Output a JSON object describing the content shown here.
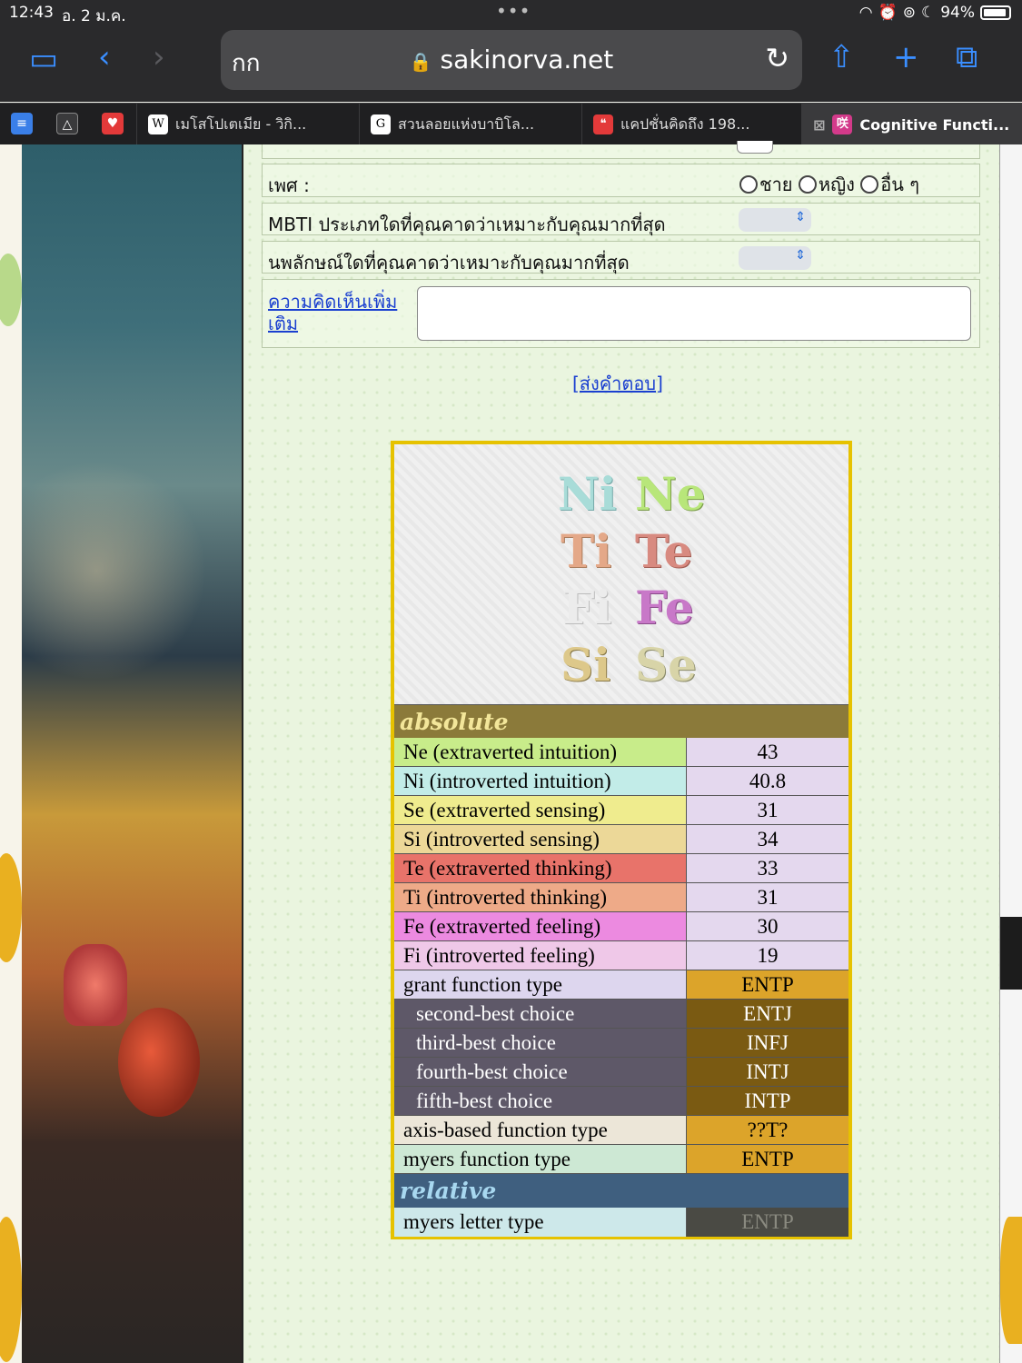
{
  "status": {
    "time": "12:43",
    "date": "อ. 2 ม.ค.",
    "battery": "94%"
  },
  "browser": {
    "aa_label": "กก",
    "url": "sakinorva.net",
    "tabs": [
      {
        "label": "เมโสโปเตเมีย - วิกิ...",
        "favicon": "W"
      },
      {
        "label": "สวนลอยแห่งบาบิโล...",
        "favicon": "G"
      },
      {
        "label": "แคปชั่นคิดถึง 198...",
        "favicon": "❝"
      },
      {
        "label": "Cognitive Functi...",
        "favicon": "咲"
      }
    ]
  },
  "form": {
    "gender_label": "เพศ :",
    "gender_options": [
      "ชาย",
      "หญิง",
      "อื่น ๆ"
    ],
    "mbti_label": "MBTI ประเภทใดที่คุณคาดว่าเหมาะกับคุณมากที่สุด",
    "enneagram_label": "นพลักษณ์ใดที่คุณคาดว่าเหมาะกับคุณมากที่สุด",
    "comment_link_line1": "ความคิดเห็นเพิ่ม",
    "comment_link_line2": "เติม",
    "submit_label": "[ส่งคำตอบ]"
  },
  "results": {
    "functions_grid": [
      [
        "Ni",
        "Ne"
      ],
      [
        "Ti",
        "Te"
      ],
      [
        "Fi",
        "Fe"
      ],
      [
        "Si",
        "Se"
      ]
    ],
    "absolute_header": "absolute",
    "scores": [
      {
        "label": "Ne (extraverted intuition)",
        "value": "43",
        "color": "#c8ec8a"
      },
      {
        "label": "Ni (introverted intuition)",
        "value": "40.8",
        "color": "#c2ece8"
      },
      {
        "label": "Se (extraverted sensing)",
        "value": "31",
        "color": "#efec8e"
      },
      {
        "label": "Si (introverted sensing)",
        "value": "34",
        "color": "#ecd898"
      },
      {
        "label": "Te (extraverted thinking)",
        "value": "33",
        "color": "#e8736a"
      },
      {
        "label": "Ti (introverted thinking)",
        "value": "31",
        "color": "#eeaa88"
      },
      {
        "label": "Fe (extraverted feeling)",
        "value": "30",
        "color": "#ec8ae0"
      },
      {
        "label": "Fi (introverted feeling)",
        "value": "19",
        "color": "#efc8e8"
      }
    ],
    "grant_label": "grant function type",
    "grant_value": "ENTP",
    "grant_choices": [
      {
        "label": "second-best choice",
        "value": "ENTJ"
      },
      {
        "label": "third-best choice",
        "value": "INFJ"
      },
      {
        "label": "fourth-best choice",
        "value": "INTJ"
      },
      {
        "label": "fifth-best choice",
        "value": "INTP"
      }
    ],
    "axis_label": "axis-based function type",
    "axis_value": "??T?",
    "myers_function_label": "myers function type",
    "myers_function_value": "ENTP",
    "relative_header": "relative",
    "myers_letter_label": "myers letter type",
    "myers_letter_value": "ENTP"
  }
}
